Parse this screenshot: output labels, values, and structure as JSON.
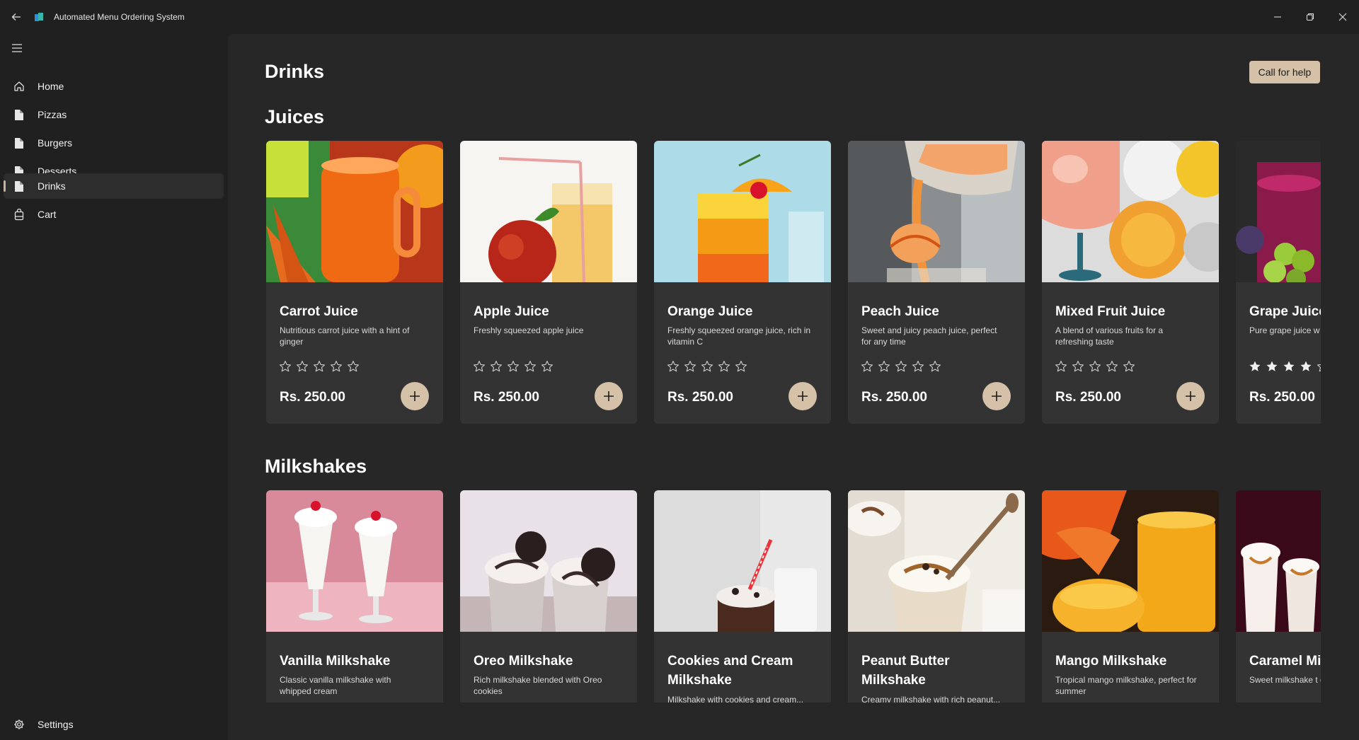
{
  "window": {
    "title": "Automated Menu Ordering System",
    "accent": "#d4c1a8"
  },
  "sidebar": {
    "items": [
      {
        "label": "Home",
        "icon": "home-icon"
      },
      {
        "label": "Pizzas",
        "icon": "document-icon"
      },
      {
        "label": "Burgers",
        "icon": "document-icon"
      },
      {
        "label": "Desserts",
        "icon": "document-icon"
      },
      {
        "label": "Drinks",
        "icon": "document-icon",
        "active": true
      },
      {
        "label": "Cart",
        "icon": "cart-icon"
      }
    ],
    "settings_label": "Settings"
  },
  "main": {
    "page_title": "Drinks",
    "help_label": "Call for help",
    "sections": [
      {
        "title": "Juices",
        "items": [
          {
            "name": "Carrot Juice",
            "desc": "Nutritious carrot juice with a hint of ginger",
            "price": "Rs. 250.00",
            "rating": 0
          },
          {
            "name": "Apple Juice",
            "desc": "Freshly squeezed apple juice",
            "price": "Rs. 250.00",
            "rating": 0
          },
          {
            "name": "Orange Juice",
            "desc": "Freshly squeezed orange juice, rich in vitamin C",
            "price": "Rs. 250.00",
            "rating": 0
          },
          {
            "name": "Peach Juice",
            "desc": "Sweet and juicy peach juice, perfect for any time",
            "price": "Rs. 250.00",
            "rating": 0
          },
          {
            "name": "Mixed Fruit Juice",
            "desc": "A blend of various fruits for a refreshing taste",
            "price": "Rs. 250.00",
            "rating": 0
          },
          {
            "name": "Grape Juice",
            "desc": "Pure grape juice w",
            "price": "Rs. 250.00",
            "rating": 4
          }
        ]
      },
      {
        "title": "Milkshakes",
        "items": [
          {
            "name": "Vanilla Milkshake",
            "desc": "Classic vanilla milkshake with whipped cream"
          },
          {
            "name": "Oreo Milkshake",
            "desc": "Rich milkshake blended with Oreo cookies"
          },
          {
            "name": "Cookies and Cream Milkshake",
            "desc": "Milkshake with cookies and cream..."
          },
          {
            "name": "Peanut Butter Milkshake",
            "desc": "Creamy milkshake with rich peanut..."
          },
          {
            "name": "Mango Milkshake",
            "desc": "Tropical mango milkshake, perfect for summer"
          },
          {
            "name": "Caramel Milkshake",
            "desc": "Sweet milkshake t drizzle"
          }
        ]
      }
    ]
  }
}
